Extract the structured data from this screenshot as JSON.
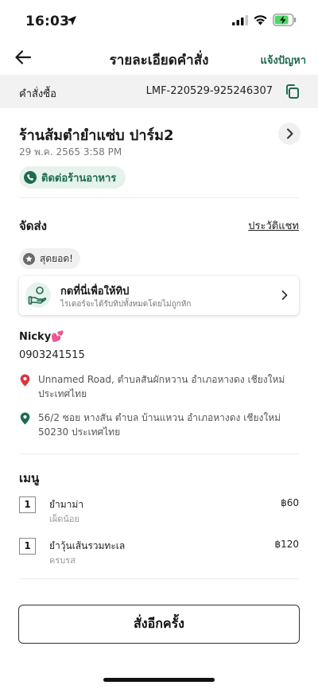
{
  "status_bar": {
    "time": "16:03"
  },
  "nav": {
    "title": "รายละเอียดคำสั่ง",
    "report": "แจ้งปัญหา"
  },
  "order": {
    "label": "คำสั่งซื้อ",
    "id": "LMF-220529-925246307"
  },
  "restaurant": {
    "name": "ร้านส้มตำยำแซ่บ ปาร์ม2",
    "datetime": "29 พ.ค. 2565 3:58 PM",
    "contact_label": "ติดต่อร้านอาหาร"
  },
  "delivery": {
    "title": "จัดส่ง",
    "chat_history": "ประวัติแชท",
    "rating": "สุดยอด!",
    "tip": {
      "title": "กดที่นี่เพื่อให้ทิป",
      "subtitle": "ไรเดอร์จะได้รับทิปทั้งหมดโดยไม่ถูกหัก"
    },
    "customer_name": "Nicky💕",
    "customer_phone": "0903241515",
    "pickup_address": "Unnamed Road, ตำบลสันผักหวาน อำเภอหางดง เชียงใหม่ ประเทศไทย",
    "dropoff_address": "56/2 ซอย หางสัน ตำบล บ้านแหวน อำเภอหางดง เชียงใหม่ 50230 ประเทศไทย"
  },
  "menu": {
    "title": "เมนู",
    "items": [
      {
        "qty": "1",
        "name": "ยำมาม่า",
        "option": "เผ็ดน้อย",
        "price": "฿60"
      },
      {
        "qty": "1",
        "name": "ยำวุ้นเส้นรวมทะเล",
        "option": "ครบรส",
        "price": "฿120"
      }
    ]
  },
  "reorder_label": "สั่งอีกครั้ง",
  "colors": {
    "accent": "#1e6b4f",
    "pickup_pin": "#d9363e",
    "dropoff_pin": "#1e6b4f"
  }
}
